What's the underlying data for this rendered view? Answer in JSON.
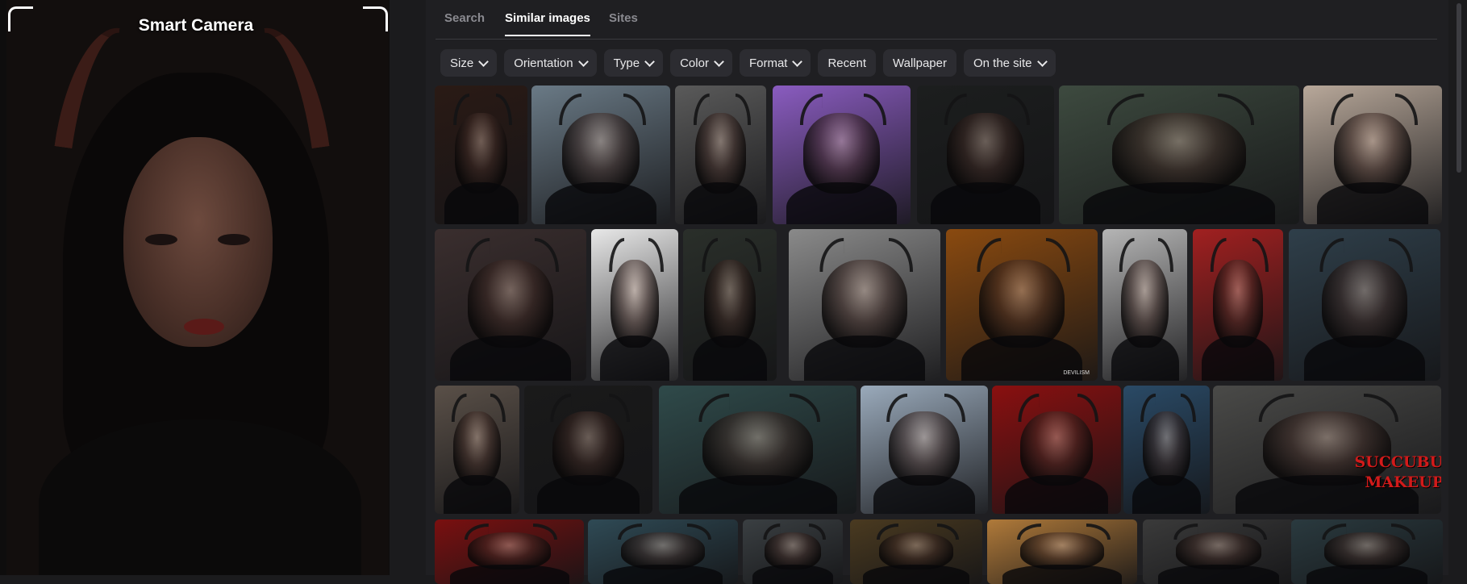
{
  "camera": {
    "title": "Smart Camera"
  },
  "tabs": [
    {
      "label": "Search",
      "active": false
    },
    {
      "label": "Similar images",
      "active": true
    },
    {
      "label": "Sites",
      "active": false
    }
  ],
  "filters": [
    {
      "label": "Size",
      "dropdown": true
    },
    {
      "label": "Orientation",
      "dropdown": true
    },
    {
      "label": "Type",
      "dropdown": true
    },
    {
      "label": "Color",
      "dropdown": true
    },
    {
      "label": "Format",
      "dropdown": true
    },
    {
      "label": "Recent",
      "dropdown": false
    },
    {
      "label": "Wallpaper",
      "dropdown": false
    },
    {
      "label": "On the site",
      "dropdown": true
    }
  ],
  "results": {
    "row1": [
      {
        "bg": "#2a1a15",
        "horn": true
      },
      {
        "bg": "#6a7a86",
        "horn": true
      },
      {
        "bg": "#5a5a5a",
        "horn": true
      },
      {
        "bg": "#8a5cc0",
        "horn": true
      },
      {
        "bg": "#1c1e1e",
        "horn": true
      },
      {
        "bg": "#3d4a3f",
        "horn": true
      },
      {
        "bg": "#b8a89a",
        "horn": true
      }
    ],
    "row2": [
      {
        "bg": "#3a2e2e",
        "horn": true
      },
      {
        "bg": "#e8e8e8",
        "horn": true
      },
      {
        "bg": "#2a2f2a",
        "horn": true
      },
      {
        "bg": "#8a8a8a",
        "horn": true
      },
      {
        "bg": "#8a4a10",
        "horn": true,
        "watermark": "DEVILISM"
      },
      {
        "bg": "#b5b5b5",
        "horn": true
      },
      {
        "bg": "#a12020",
        "horn": true
      },
      {
        "bg": "#2f3f4a",
        "horn": true
      }
    ],
    "row3": [
      {
        "bg": "#5a5048",
        "horn": true
      },
      {
        "bg": "#1a1a1a",
        "horn": true
      },
      {
        "bg": "#2f4a4a",
        "horn": true
      },
      {
        "bg": "#9aaabb",
        "horn": true
      },
      {
        "bg": "#8a1010",
        "horn": true
      },
      {
        "bg": "#2a4a66",
        "horn": true
      },
      {
        "bg": "#4a4a48",
        "horn": true,
        "text": [
          "SUCCUBUS",
          "MAKEUP"
        ]
      }
    ],
    "row4": [
      {
        "bg": "#7a1010",
        "horn": true
      },
      {
        "bg": "#2f4a55",
        "horn": true
      },
      {
        "bg": "#3a3f42",
        "horn": true
      },
      {
        "bg": "#4a3a20",
        "horn": true
      },
      {
        "bg": "#b07a3a",
        "horn": true
      },
      {
        "bg": "#3a3a3a",
        "horn": true
      },
      {
        "bg": "#2a3a3f",
        "horn": true
      }
    ]
  }
}
